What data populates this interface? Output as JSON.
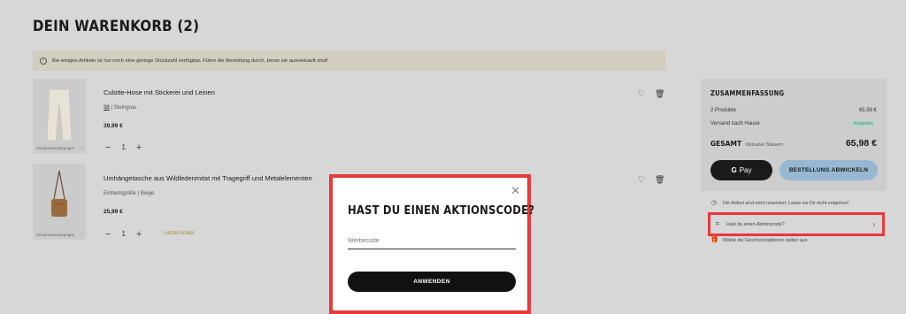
{
  "cart": {
    "title": "DEIN WARENKORB (2)",
    "notice": "Bei einigen Artikeln ist nur noch eine geringe Stückzahl verfügbar. Führe die Bestellung durch, bevor sie ausverkauft sind!",
    "items": [
      {
        "name": "Culotte-Hose mit Stickerei und Leinen",
        "size": "38",
        "color": "Steingrau",
        "price": "39,99 €",
        "quantity": "1",
        "thumb_caption": "Zusammensetzungen",
        "last_item": ""
      },
      {
        "name": "Umhängetasche aus Wildlederimitat mit Tragegriff und Metalelementen",
        "size": "Einheitsgröße",
        "color": "Beige",
        "price": "25,99 €",
        "quantity": "1",
        "thumb_caption": "Zusammensetzungen",
        "last_item": "Letzte Artikel"
      }
    ]
  },
  "summary": {
    "title": "ZUSAMMENFASSUNG",
    "products_label": "2 Produkte",
    "products_value": "65,98 €",
    "shipping_label": "Versand nach Hause",
    "shipping_badge": "Kostenlos",
    "total_label": "GESAMT",
    "total_tax_note": "Inklusive Steuern",
    "total_value": "65,98 €",
    "gpay_label": "Pay",
    "checkout_label": "BESTELLUNG ABWICKELN"
  },
  "side_notes": {
    "reserved_note": "Die Artikel sind nicht reserviert. Lasse sie Dir nicht entgehen!",
    "promo_link": "Hast du einen Aktionscode?",
    "gift_note": "Wähle die Geschenkoptionen später aus"
  },
  "modal": {
    "title": "HAST DU EINEN AKTIONSCODE?",
    "input_placeholder": "Werbecode",
    "input_value": "",
    "apply_label": "ANWENDEN"
  },
  "icons": {
    "info": "info-icon",
    "heart": "heart-icon",
    "trash": "trash-icon",
    "close": "close-icon",
    "tag": "tag-icon",
    "gift": "gift-icon",
    "chevron": "chevron-right-icon"
  },
  "colors": {
    "overlay_bg": "#d7d7d7",
    "highlight_border": "#e8383a",
    "checkout_btn": "#97b7d2",
    "free_badge_text": "#3a8a6a",
    "last_item_text": "#b08a2e"
  }
}
